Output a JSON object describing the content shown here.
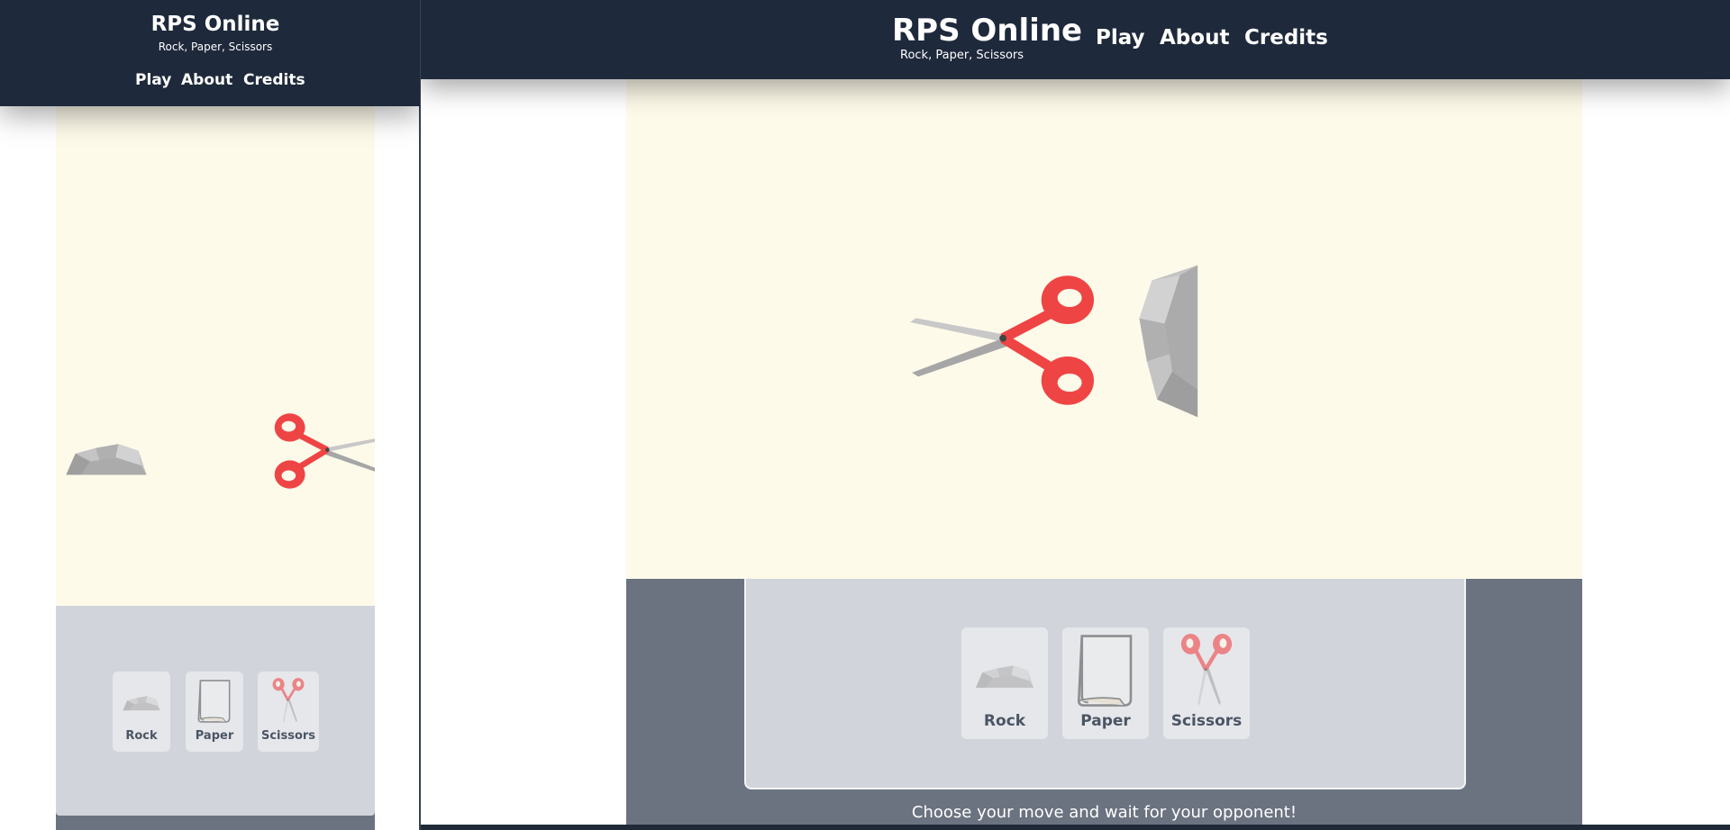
{
  "app": {
    "title": "RPS Online",
    "subtitle": "Rock, Paper, Scissors"
  },
  "nav": {
    "play": "Play",
    "about": "About",
    "credits": "Credits"
  },
  "moves": {
    "rock": "Rock",
    "paper": "Paper",
    "scissors": "Scissors"
  },
  "status": "Choose your move and wait for your opponent!",
  "colors": {
    "header": "#1e293b",
    "arena": "#fefaea",
    "controls": "#6b7280",
    "move_box": "#d1d5db",
    "scissors_handle": "#ef4444"
  }
}
